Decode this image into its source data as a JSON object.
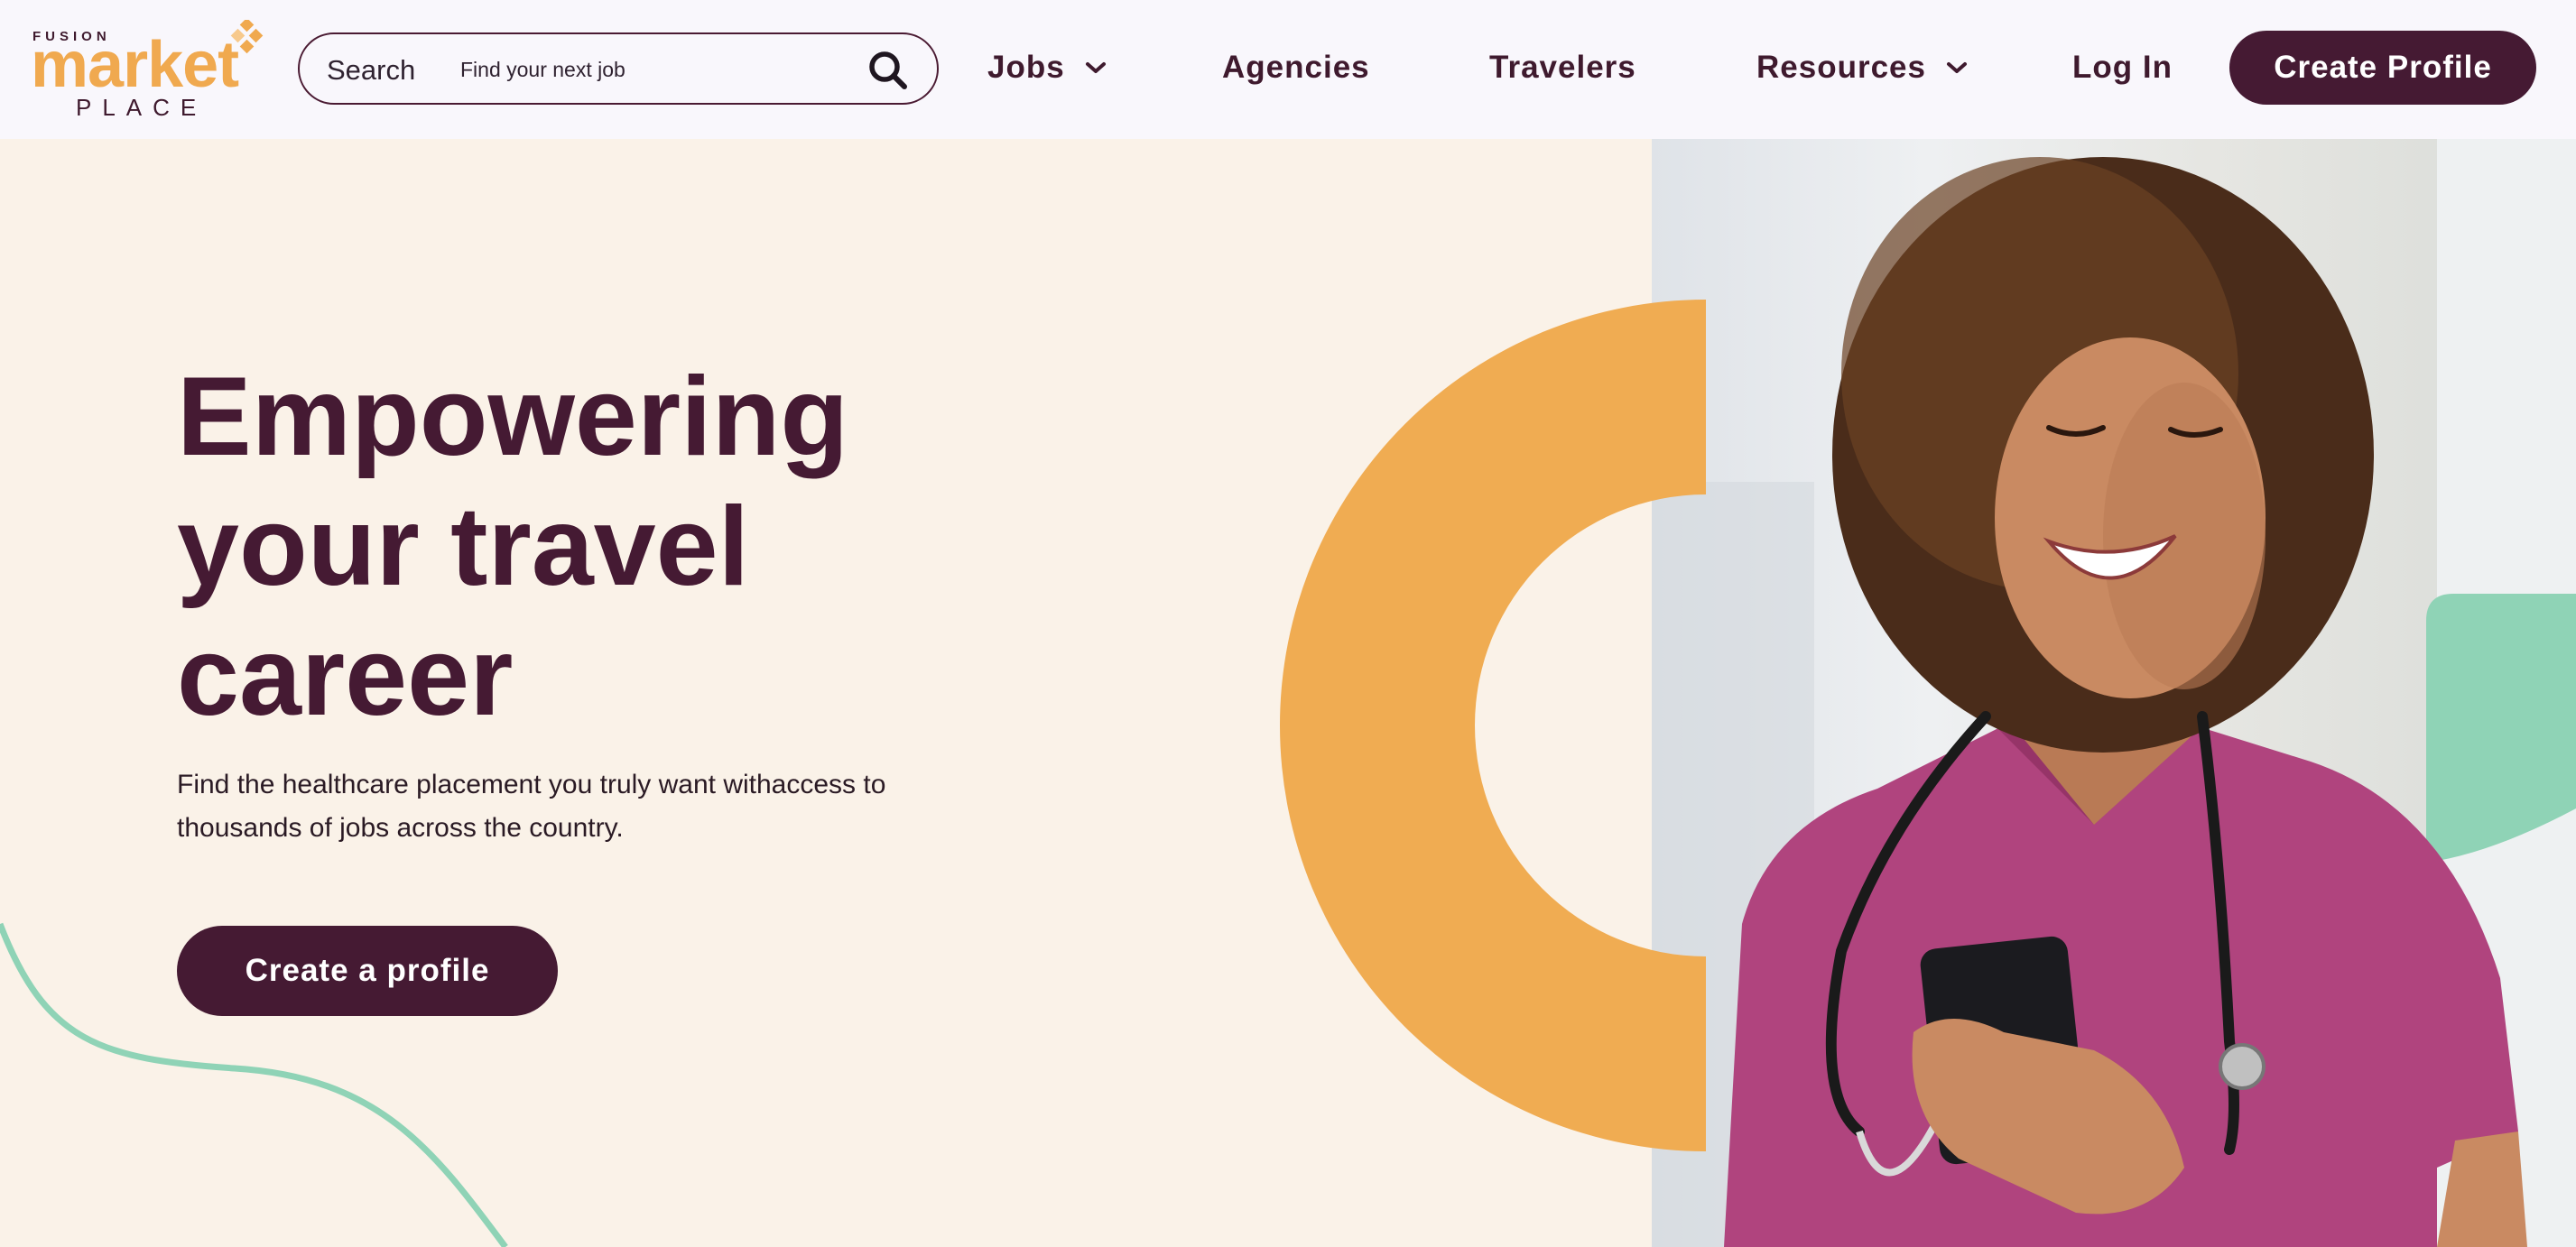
{
  "brand": {
    "top": "FUSION",
    "main": "market",
    "bottom": "PLACE",
    "colors": {
      "primary": "#451a33",
      "accent": "#f0a94f",
      "mint": "#8fd3b6",
      "cream": "#faf2e8",
      "scrubs": "#b0447e"
    }
  },
  "search": {
    "label": "Search",
    "placeholder": "Find your next job",
    "icon": "search-icon"
  },
  "nav": {
    "jobs": "Jobs",
    "agencies": "Agencies",
    "travelers": "Travelers",
    "resources": "Resources",
    "login": "Log In",
    "create_profile": "Create Profile"
  },
  "hero": {
    "headline": [
      "Empowering",
      "your travel",
      "career"
    ],
    "subtext_line1": "Find the healthcare placement you truly want withaccess to",
    "subtext_line2": "thousands of jobs across the country.",
    "cta": "Create a profile"
  }
}
